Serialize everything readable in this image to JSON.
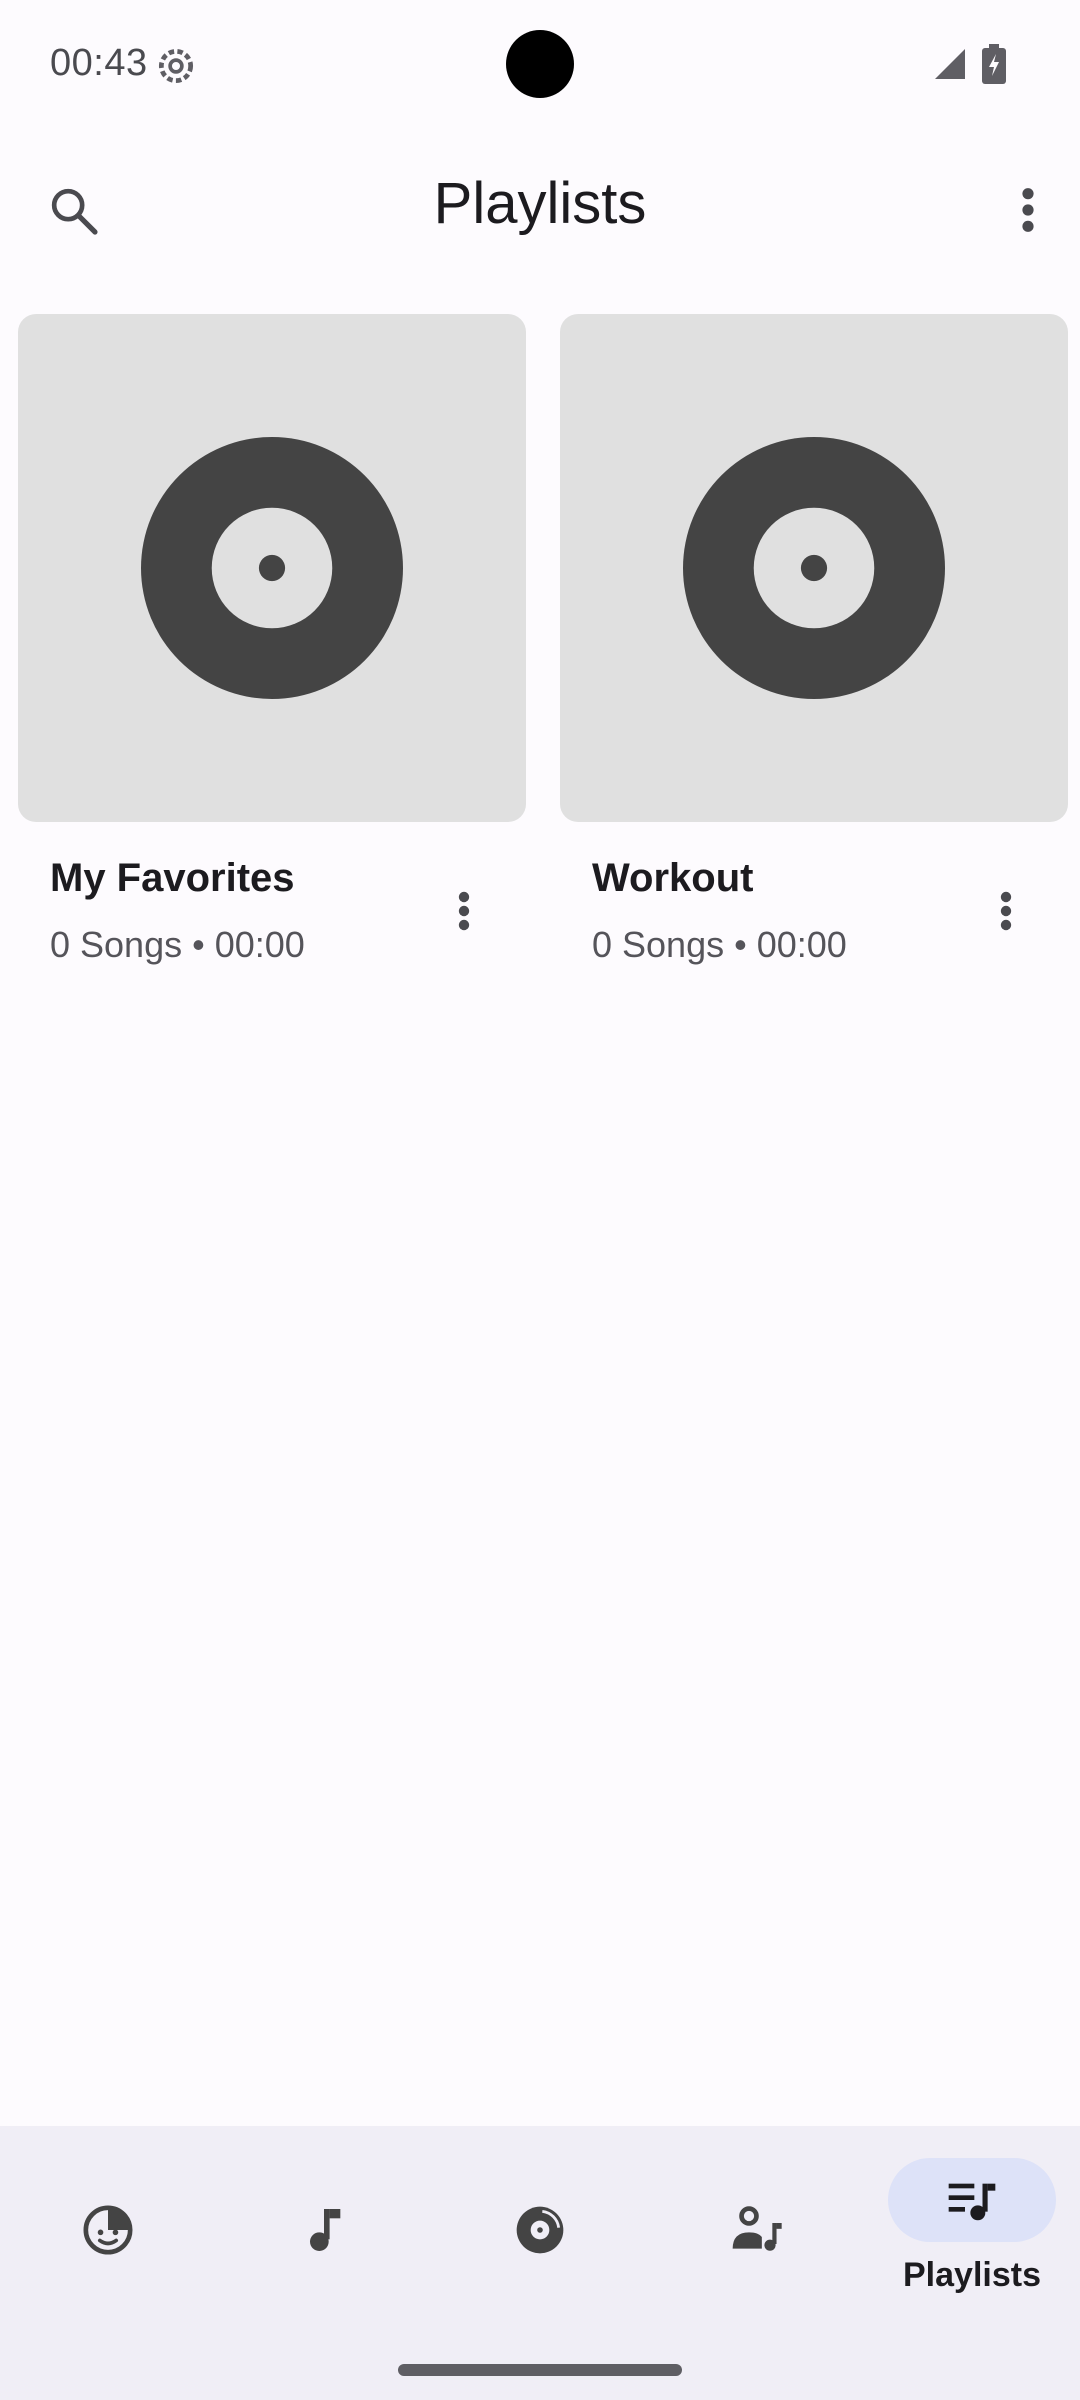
{
  "status_bar": {
    "time": "00:43",
    "icons": [
      "gear-icon",
      "signal-icon",
      "battery-charging-icon"
    ]
  },
  "top_bar": {
    "title": "Playlists",
    "search_icon": "search-icon",
    "more_icon": "more-vert-icon"
  },
  "playlists": [
    {
      "title": "My Favorites",
      "subtitle": "0 Songs  •  00:00",
      "art_icon": "vinyl-record-icon"
    },
    {
      "title": "Workout",
      "subtitle": "0 Songs  •  00:00",
      "art_icon": "vinyl-record-icon"
    }
  ],
  "bottom_nav": {
    "items": [
      {
        "icon": "face-icon",
        "label": "",
        "active": false
      },
      {
        "icon": "music-note-icon",
        "label": "",
        "active": false
      },
      {
        "icon": "album-icon",
        "label": "",
        "active": false
      },
      {
        "icon": "artist-icon",
        "label": "",
        "active": false
      },
      {
        "icon": "playlist-icon",
        "label": "Playlists",
        "active": true
      }
    ]
  },
  "colors": {
    "background": "#fdfbfe",
    "nav_background": "#f0eef6",
    "active_pill": "#dde2f8",
    "art_background": "#e0e0e0",
    "icon_dark": "#444444"
  }
}
